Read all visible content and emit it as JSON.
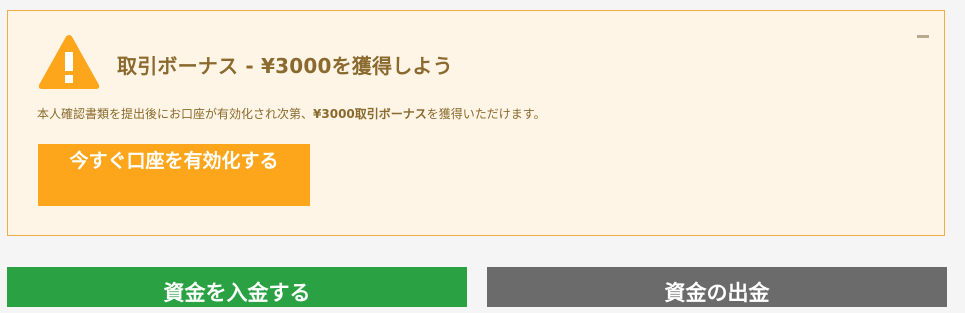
{
  "banner": {
    "title": "取引ボーナス - ¥3000を獲得しよう",
    "body_prefix": "本人確認書類を提出後にお口座が有効化され次第、",
    "body_bold": "¥3000取引ボーナス",
    "body_suffix": "を獲得いただけます。",
    "cta_label": "今すぐ口座を有効化する",
    "icon": "warning-icon",
    "accent_color": "#fea61b",
    "background_color": "#fef5e6"
  },
  "actions": {
    "deposit_label": "資金を入金する",
    "withdraw_label": "資金の出金",
    "deposit_color": "#2aa243",
    "withdraw_color": "#6b6b6b"
  }
}
